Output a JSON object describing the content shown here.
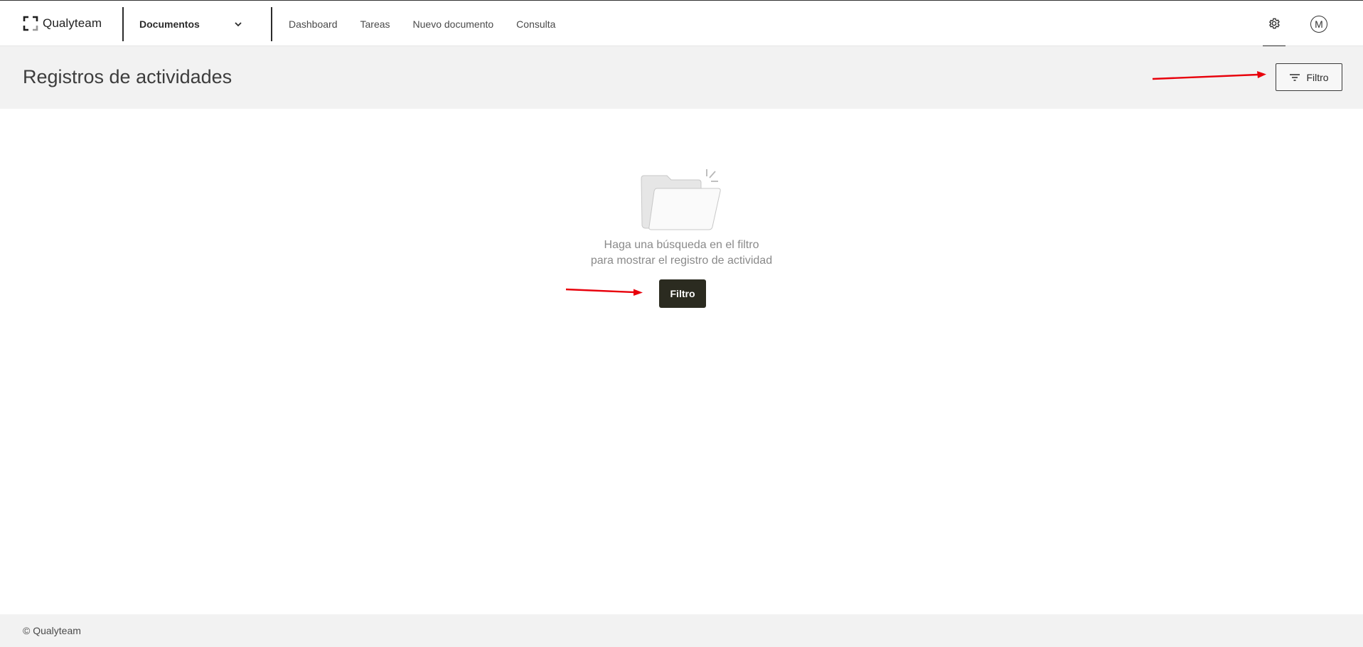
{
  "app": {
    "brand": "Qualyteam",
    "module": "Documentos"
  },
  "nav": {
    "items": [
      "Dashboard",
      "Tareas",
      "Nuevo documento",
      "Consulta"
    ]
  },
  "user": {
    "initial": "M"
  },
  "page": {
    "title": "Registros de actividades",
    "filter_label": "Filtro"
  },
  "empty_state": {
    "line1": "Haga una búsqueda en el filtro",
    "line2": "para mostrar el registro de actividad",
    "button_label": "Filtro"
  },
  "footer": {
    "text": "© Qualyteam"
  },
  "icons": {
    "logo": "qualyteam-logo-icon",
    "module_chevron": "chevron-down-icon",
    "settings": "gear-icon",
    "filter": "filter-lines-icon",
    "empty": "empty-folder-icon",
    "annotation": "red-arrow-icon"
  },
  "colors": {
    "primary_button": "#2b2b20",
    "header_band": "#f2f2f2",
    "annotation": "#e8000b"
  }
}
